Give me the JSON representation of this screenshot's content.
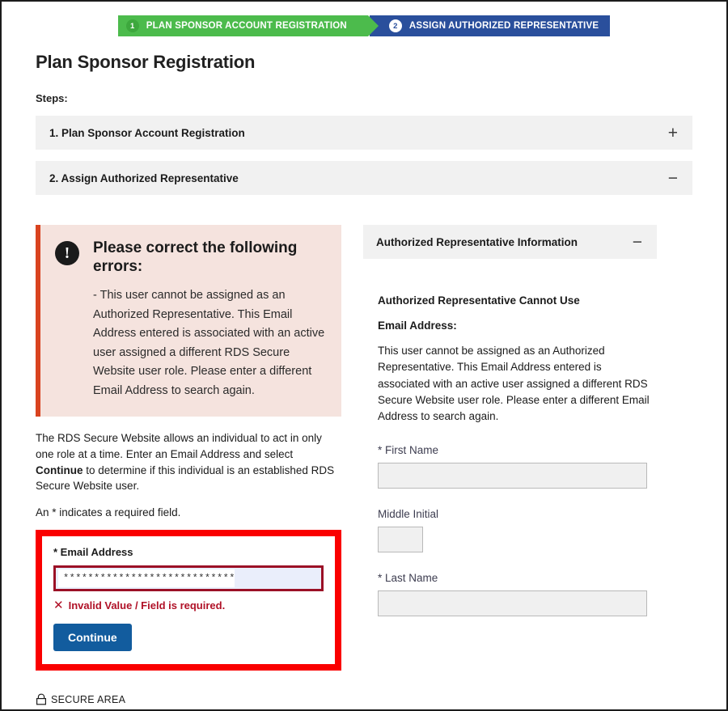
{
  "progress": {
    "steps": [
      {
        "number": "1",
        "label": "PLAN SPONSOR ACCOUNT REGISTRATION",
        "state": "done",
        "color": "#4cbb4c"
      },
      {
        "number": "2",
        "label": "ASSIGN AUTHORIZED REPRESENTATIVE",
        "state": "current",
        "color": "#2a4f9c"
      }
    ]
  },
  "page_title": "Plan Sponsor Registration",
  "steps_label": "Steps:",
  "accordions": [
    {
      "title": "1. Plan Sponsor Account Registration",
      "icon": "plus-icon",
      "glyph": "+"
    },
    {
      "title": "2. Assign Authorized Representative",
      "icon": "minus-icon",
      "glyph": "−"
    }
  ],
  "alert": {
    "icon": "exclamation-circle-icon",
    "glyph": "!",
    "title": "Please correct the following errors:",
    "items": [
      "-  This user cannot be assigned as an Authorized Representative. This Email Address entered is associated with an active user assigned a different RDS Secure Website user role. Please enter a different Email Address to search again."
    ],
    "accent_color": "#d9431f",
    "background_color": "#f5e3de"
  },
  "intro": {
    "part1": "The RDS Secure Website allows an individual to act in only one role at a time. Enter an Email Address and select ",
    "bold": "Continue",
    "part2": " to determine if this individual is an established RDS Secure Website user.",
    "required_note": "An * indicates a required field."
  },
  "email_form": {
    "label": "* Email Address",
    "value": "**********************************",
    "placeholder": "",
    "error_icon": "x-icon",
    "error_glyph": "✕",
    "error_text": "Invalid Value / Field is required.",
    "button_label": "Continue",
    "button_color": "#125c9e",
    "highlight_color": "#fa0000",
    "field_border_color": "#9b1026"
  },
  "right_panel": {
    "header": "Authorized Representative Information",
    "header_icon": "minus-icon",
    "header_glyph": "−",
    "readonly_title": "Authorized Representative Cannot Use",
    "readonly_subtitle": "Email Address:",
    "readonly_text": "This user cannot be assigned as an Authorized Representative. This Email Address entered is associated with an active user assigned a different RDS Secure Website user role. Please enter a different Email Address to search again.",
    "fields": [
      {
        "label": "* First Name",
        "value": "",
        "size": "full"
      },
      {
        "label": "Middle Initial",
        "value": "",
        "size": "small"
      },
      {
        "label": "* Last Name",
        "value": "",
        "size": "full"
      }
    ]
  },
  "footer": {
    "icon": "lock-icon",
    "text": "SECURE AREA"
  }
}
